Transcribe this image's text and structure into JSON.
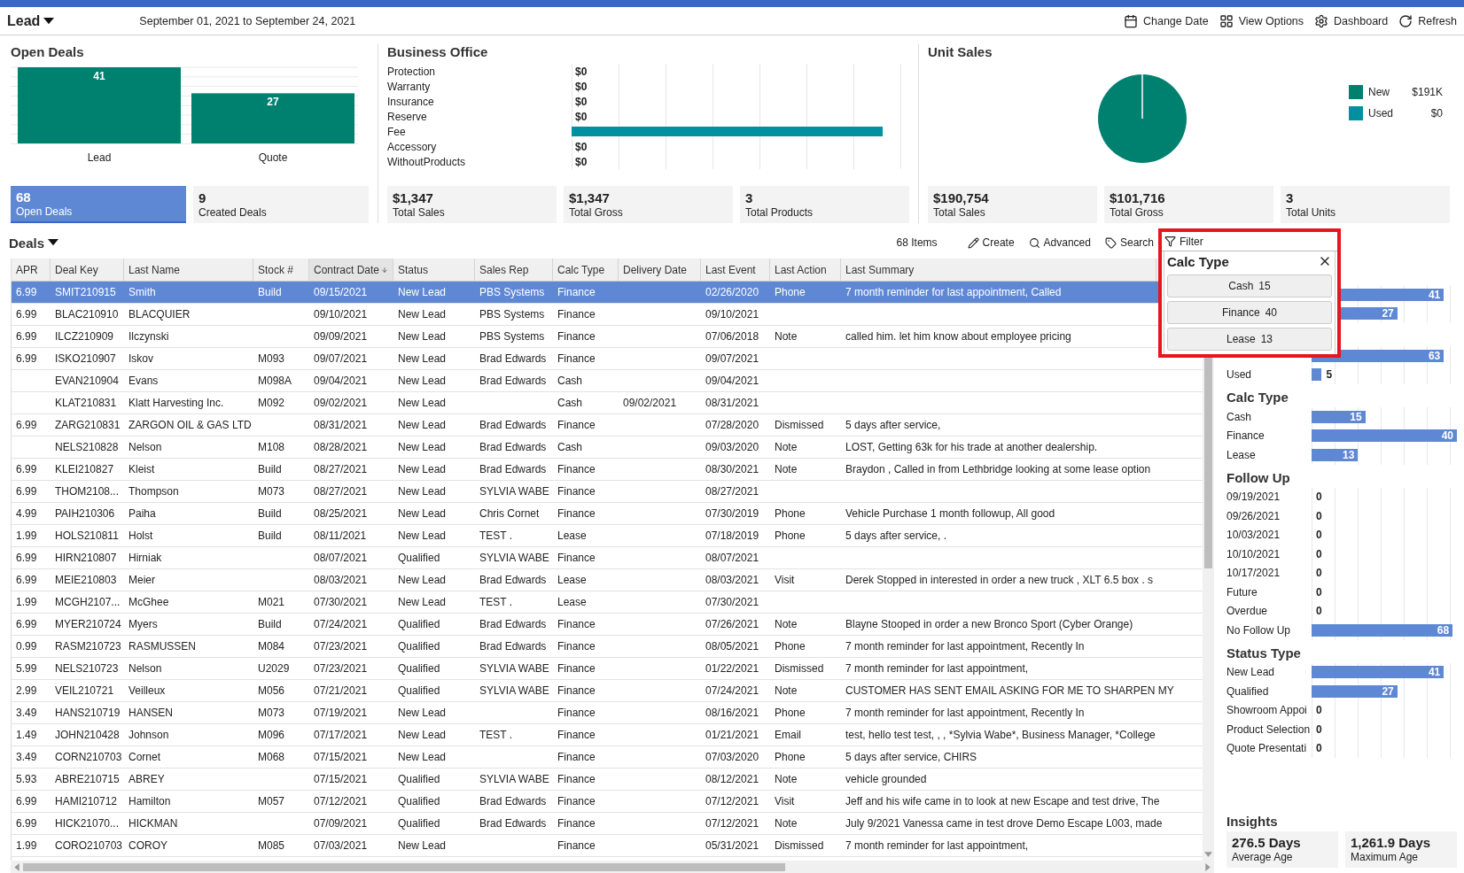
{
  "header": {
    "title": "Lead",
    "date_range": "September 01, 2021 to September 24, 2021",
    "actions": [
      {
        "label": "Change Date",
        "kind": "calendar"
      },
      {
        "label": "View Options",
        "kind": "grid"
      },
      {
        "label": "Dashboard",
        "kind": "gear"
      },
      {
        "label": "Refresh",
        "kind": "refresh"
      }
    ]
  },
  "open_deals": {
    "title": "Open Deals",
    "chart_data": {
      "type": "bar",
      "categories": [
        "Lead",
        "Quote"
      ],
      "values": [
        41,
        27
      ],
      "data_labels": true
    },
    "cards": [
      {
        "value": "68",
        "label": "Open Deals",
        "selected": true
      },
      {
        "value": "9",
        "label": "Created Deals",
        "selected": false
      }
    ]
  },
  "business_office": {
    "title": "Business Office",
    "rows": [
      {
        "label": "Protection",
        "value": "$0"
      },
      {
        "label": "Warranty",
        "value": "$0"
      },
      {
        "label": "Insurance",
        "value": "$0"
      },
      {
        "label": "Reserve",
        "value": "$0"
      },
      {
        "label": "Fee",
        "level": 0.92
      },
      {
        "label": "Accessory",
        "value": "$0"
      },
      {
        "label": "WithoutProducts",
        "value": "$0"
      }
    ],
    "cards": [
      {
        "value": "$1,347",
        "label": "Total Sales",
        "selected": false
      },
      {
        "value": "$1,347",
        "label": "Total Gross",
        "selected": false
      },
      {
        "value": "3",
        "label": "Total Products",
        "selected": false
      }
    ]
  },
  "unit_sales": {
    "title": "Unit Sales",
    "chart_data": {
      "type": "pie",
      "categories": [
        "New",
        "Used"
      ],
      "values": [
        100,
        0
      ],
      "needle": "New"
    },
    "legend": [
      {
        "value": "$191K",
        "color": "#00806f"
      },
      {
        "value": "$0",
        "color": "#0090a0"
      }
    ],
    "cards": [
      {
        "value": "$190,754",
        "label": "Total Sales",
        "selected": false
      },
      {
        "value": "$101,716",
        "label": "Total Gross",
        "selected": false
      },
      {
        "value": "3",
        "label": "Total Units",
        "selected": false
      }
    ]
  },
  "deals": {
    "title": "Deals",
    "item_count": "68 Items",
    "actions": [
      {
        "label": "Create",
        "kind": "pencil"
      },
      {
        "label": "Advanced",
        "kind": "search"
      },
      {
        "label": "Search",
        "kind": "tag"
      }
    ],
    "columns": [
      {
        "label": "APR",
        "sorted": false
      },
      {
        "label": "Deal Key",
        "sorted": false
      },
      {
        "label": "Last Name",
        "sorted": false
      },
      {
        "label": "Stock #",
        "sorted": false
      },
      {
        "label": "Contract Date",
        "sorted": true
      },
      {
        "label": "Status",
        "sorted": false
      },
      {
        "label": "Sales Rep",
        "sorted": false
      },
      {
        "label": "Calc Type",
        "sorted": false
      },
      {
        "label": "Delivery Date",
        "sorted": false
      },
      {
        "label": "Last Event",
        "sorted": false
      },
      {
        "label": "Last Action",
        "sorted": false
      },
      {
        "label": "Last Summary",
        "sorted": false
      }
    ],
    "rows": [
      {
        "selected": true,
        "apr": "6.99",
        "deal_key": "SMIT210915",
        "last_name": "Smith",
        "stock": "Build",
        "contract_date": "09/15/2021",
        "status": "New Lead",
        "sales_rep": "PBS Systems",
        "calc_type": "Finance",
        "last_event": "02/26/2020",
        "last_action": "Phone",
        "last_summary": "7 month reminder for last appointment, Called"
      },
      {
        "selected": false,
        "apr": "6.99",
        "deal_key": "BLAC210910",
        "last_name": "BLACQUIER",
        "contract_date": "09/10/2021",
        "status": "New Lead",
        "sales_rep": "PBS Systems",
        "calc_type": "Finance",
        "last_event": "09/10/2021"
      },
      {
        "selected": false,
        "apr": "6.99",
        "deal_key": "ILCZ210909",
        "last_name": "Ilczynski",
        "contract_date": "09/09/2021",
        "status": "New Lead",
        "sales_rep": "PBS Systems",
        "calc_type": "Finance",
        "last_event": "07/06/2018",
        "last_action": "Note",
        "last_summary": "called him. let him know about employee pricing"
      },
      {
        "selected": false,
        "apr": "6.99",
        "deal_key": "ISKO210907",
        "last_name": "Iskov",
        "stock": "M093",
        "contract_date": "09/07/2021",
        "status": "New Lead",
        "sales_rep": "Brad Edwards",
        "calc_type": "Finance",
        "last_event": "09/07/2021"
      },
      {
        "selected": false,
        "deal_key": "EVAN210904",
        "last_name": "Evans",
        "stock": "M098A",
        "contract_date": "09/04/2021",
        "status": "New Lead",
        "sales_rep": "Brad Edwards",
        "calc_type": "Cash",
        "last_event": "09/04/2021"
      },
      {
        "selected": false,
        "deal_key": "KLAT210831",
        "last_name": "Klatt Harvesting Inc.",
        "stock": "M092",
        "contract_date": "09/02/2021",
        "status": "New Lead",
        "calc_type": "Cash",
        "delivery_date": "09/02/2021",
        "last_event": "08/31/2021"
      },
      {
        "selected": false,
        "apr": "6.99",
        "deal_key": "ZARG210831",
        "last_name": "ZARGON OIL & GAS LTD",
        "contract_date": "08/31/2021",
        "status": "New Lead",
        "sales_rep": "Brad Edwards",
        "calc_type": "Finance",
        "last_event": "07/28/2020",
        "last_action": "Dismissed",
        "last_summary": "5 days after service,"
      },
      {
        "selected": false,
        "deal_key": "NELS210828",
        "last_name": "Nelson",
        "stock": "M108",
        "contract_date": "08/28/2021",
        "status": "New Lead",
        "sales_rep": "Brad Edwards",
        "calc_type": "Cash",
        "last_event": "09/03/2020",
        "last_action": "Note",
        "last_summary": "LOST, Getting 63k for his trade at another dealership."
      },
      {
        "selected": false,
        "apr": "6.99",
        "deal_key": "KLEI210827",
        "last_name": "Kleist",
        "stock": "Build",
        "contract_date": "08/27/2021",
        "status": "New Lead",
        "sales_rep": "Brad Edwards",
        "calc_type": "Finance",
        "last_event": "08/30/2021",
        "last_action": "Note",
        "last_summary": "Braydon , Called in from Lethbridge looking at some lease option"
      },
      {
        "selected": false,
        "apr": "6.99",
        "deal_key": "THOM2108...",
        "last_name": "Thompson",
        "stock": "M073",
        "contract_date": "08/27/2021",
        "status": "New Lead",
        "sales_rep": "SYLVIA WABE",
        "calc_type": "Finance",
        "last_event": "08/27/2021"
      },
      {
        "selected": false,
        "apr": "4.99",
        "deal_key": "PAIH210306",
        "last_name": "Paiha",
        "stock": "Build",
        "contract_date": "08/25/2021",
        "status": "New Lead",
        "sales_rep": "Chris Cornet",
        "calc_type": "Finance",
        "last_event": "07/30/2019",
        "last_action": "Phone",
        "last_summary": "Vehicle Purchase 1 month followup, All good"
      },
      {
        "selected": false,
        "apr": "1.99",
        "deal_key": "HOLS210811",
        "last_name": "Holst",
        "stock": "Build",
        "contract_date": "08/11/2021",
        "status": "New Lead",
        "sales_rep": "TEST .",
        "calc_type": "Lease",
        "last_event": "07/18/2019",
        "last_action": "Phone",
        "last_summary": "5 days after service, ."
      },
      {
        "selected": false,
        "apr": "6.99",
        "deal_key": "HIRN210807",
        "last_name": "Hirniak",
        "contract_date": "08/07/2021",
        "status": "Qualified",
        "sales_rep": "SYLVIA WABE",
        "calc_type": "Finance",
        "last_event": "08/07/2021"
      },
      {
        "selected": false,
        "apr": "6.99",
        "deal_key": "MEIE210803",
        "last_name": "Meier",
        "contract_date": "08/03/2021",
        "status": "New Lead",
        "sales_rep": "Brad Edwards",
        "calc_type": "Lease",
        "last_event": "08/03/2021",
        "last_action": "Visit",
        "last_summary": "Derek Stopped in interested in order a new truck , XLT 6.5 box . s"
      },
      {
        "selected": false,
        "apr": "1.99",
        "deal_key": "MCGH2107...",
        "last_name": "McGhee",
        "stock": "M021",
        "contract_date": "07/30/2021",
        "status": "New Lead",
        "sales_rep": "TEST .",
        "calc_type": "Lease",
        "last_event": "07/30/2021"
      },
      {
        "selected": false,
        "apr": "6.99",
        "deal_key": "MYER210724",
        "last_name": "Myers",
        "stock": "Build",
        "contract_date": "07/24/2021",
        "status": "Qualified",
        "sales_rep": "Brad Edwards",
        "calc_type": "Finance",
        "last_event": "07/26/2021",
        "last_action": "Note",
        "last_summary": "Blayne Stooped in order a new Bronco Sport (Cyber Orange)"
      },
      {
        "selected": false,
        "apr": "0.99",
        "deal_key": "RASM210723",
        "last_name": "RASMUSSEN",
        "stock": "M084",
        "contract_date": "07/23/2021",
        "status": "Qualified",
        "sales_rep": "Brad Edwards",
        "calc_type": "Finance",
        "last_event": "08/05/2021",
        "last_action": "Phone",
        "last_summary": "7 month reminder for last appointment, Recently In"
      },
      {
        "selected": false,
        "apr": "5.99",
        "deal_key": "NELS210723",
        "last_name": "Nelson",
        "stock": "U2029",
        "contract_date": "07/23/2021",
        "status": "Qualified",
        "sales_rep": "SYLVIA WABE",
        "calc_type": "Finance",
        "last_event": "01/22/2021",
        "last_action": "Dismissed",
        "last_summary": "7 month reminder for last appointment,"
      },
      {
        "selected": false,
        "apr": "2.99",
        "deal_key": "VEIL210721",
        "last_name": "Veilleux",
        "stock": "M056",
        "contract_date": "07/21/2021",
        "status": "Qualified",
        "sales_rep": "SYLVIA WABE",
        "calc_type": "Finance",
        "last_event": "07/24/2021",
        "last_action": "Note",
        "last_summary": "CUSTOMER HAS SENT EMAIL ASKING FOR ME TO SHARPEN MY"
      },
      {
        "selected": false,
        "apr": "3.49",
        "deal_key": "HANS210719",
        "last_name": "HANSEN",
        "stock": "M073",
        "contract_date": "07/19/2021",
        "status": "New Lead",
        "calc_type": "Finance",
        "last_event": "08/16/2021",
        "last_action": "Phone",
        "last_summary": "7 month reminder for last appointment, Recently In"
      },
      {
        "selected": false,
        "apr": "1.49",
        "deal_key": "JOHN210428",
        "last_name": "Johnson",
        "stock": "M096",
        "contract_date": "07/17/2021",
        "status": "New Lead",
        "sales_rep": "TEST .",
        "calc_type": "Finance",
        "last_event": "01/21/2021",
        "last_action": "Email",
        "last_summary": "test, hello test test, , , *Sylvia Wabe*, Business Manager, *College"
      },
      {
        "selected": false,
        "apr": "3.49",
        "deal_key": "CORN210703",
        "last_name": "Cornet",
        "stock": "M068",
        "contract_date": "07/15/2021",
        "status": "New Lead",
        "calc_type": "Finance",
        "last_event": "07/03/2020",
        "last_action": "Phone",
        "last_summary": "5 days after service, CHIRS"
      },
      {
        "selected": false,
        "apr": "5.93",
        "deal_key": "ABRE210715",
        "last_name": "ABREY",
        "contract_date": "07/15/2021",
        "status": "Qualified",
        "sales_rep": "SYLVIA WABE",
        "calc_type": "Finance",
        "last_event": "08/12/2021",
        "last_action": "Note",
        "last_summary": "vehicle grounded"
      },
      {
        "selected": false,
        "apr": "6.99",
        "deal_key": "HAMI210712",
        "last_name": "Hamilton",
        "stock": "M057",
        "contract_date": "07/12/2021",
        "status": "Qualified",
        "sales_rep": "Brad Edwards",
        "calc_type": "Finance",
        "last_event": "07/12/2021",
        "last_action": "Visit",
        "last_summary": "Jeff and his wife came in to look at new Escape and test drive, The"
      },
      {
        "selected": false,
        "apr": "6.99",
        "deal_key": "HICK21070...",
        "last_name": "HICKMAN",
        "contract_date": "07/09/2021",
        "status": "Qualified",
        "sales_rep": "Brad Edwards",
        "calc_type": "Finance",
        "last_event": "07/12/2021",
        "last_action": "Note",
        "last_summary": "July 9/2021 Vanessa came in test drove Demo Escape L003, made"
      },
      {
        "selected": false,
        "apr": "1.99",
        "deal_key": "CORO210703",
        "last_name": "COROY",
        "stock": "M085",
        "contract_date": "07/03/2021",
        "status": "New Lead",
        "calc_type": "Finance",
        "last_event": "05/31/2021",
        "last_action": "Dismissed",
        "last_summary": "7 month reminder for last appointment,"
      }
    ]
  },
  "filter_popup": {
    "label": "Filter",
    "title": "Calc Type",
    "options": [
      {
        "label": "Cash",
        "count": "15"
      },
      {
        "label": "Finance",
        "count": "40"
      },
      {
        "label": "Lease",
        "count": "13"
      }
    ]
  },
  "sidebar": {
    "sections": [
      {
        "rows": [
          {
            "value": "41",
            "level": 0.91
          },
          {
            "value": "27",
            "level": 0.59
          }
        ]
      },
      {
        "rows": [
          {
            "value": "63",
            "level": 0.91
          },
          {
            "label": "Used",
            "value": "5",
            "level": 0.07
          }
        ]
      },
      {
        "title": "Calc Type",
        "rows": [
          {
            "label": "Cash",
            "value": "15",
            "level": 0.37
          },
          {
            "label": "Finance",
            "value": "40",
            "level": 1
          },
          {
            "label": "Lease",
            "value": "13",
            "level": 0.32
          }
        ]
      },
      {
        "title": "Follow Up",
        "rows": [
          {
            "label": "09/19/2021",
            "value": "0"
          },
          {
            "label": "09/26/2021",
            "value": "0"
          },
          {
            "label": "10/03/2021",
            "value": "0"
          },
          {
            "label": "10/10/2021",
            "value": "0"
          },
          {
            "label": "10/17/2021",
            "value": "0"
          },
          {
            "label": "Future",
            "value": "0"
          },
          {
            "label": "Overdue",
            "value": "0"
          },
          {
            "label": "No Follow Up",
            "value": "68",
            "level": 0.97
          }
        ]
      },
      {
        "title": "Status Type",
        "rows": [
          {
            "label": "New Lead",
            "value": "41",
            "level": 0.91
          },
          {
            "label": "Qualified",
            "value": "27",
            "level": 0.59
          },
          {
            "label": "Showroom Appoi",
            "value": "0"
          },
          {
            "label": "Product Selection",
            "value": "0"
          },
          {
            "label": "Quote Presentati",
            "value": "0"
          }
        ]
      }
    ],
    "insights": {
      "title": "Insights",
      "cards": [
        {
          "value": "276.5 Days",
          "label": "Average Age"
        },
        {
          "value": "1,261.9 Days",
          "label": "Maximum Age"
        }
      ]
    }
  }
}
